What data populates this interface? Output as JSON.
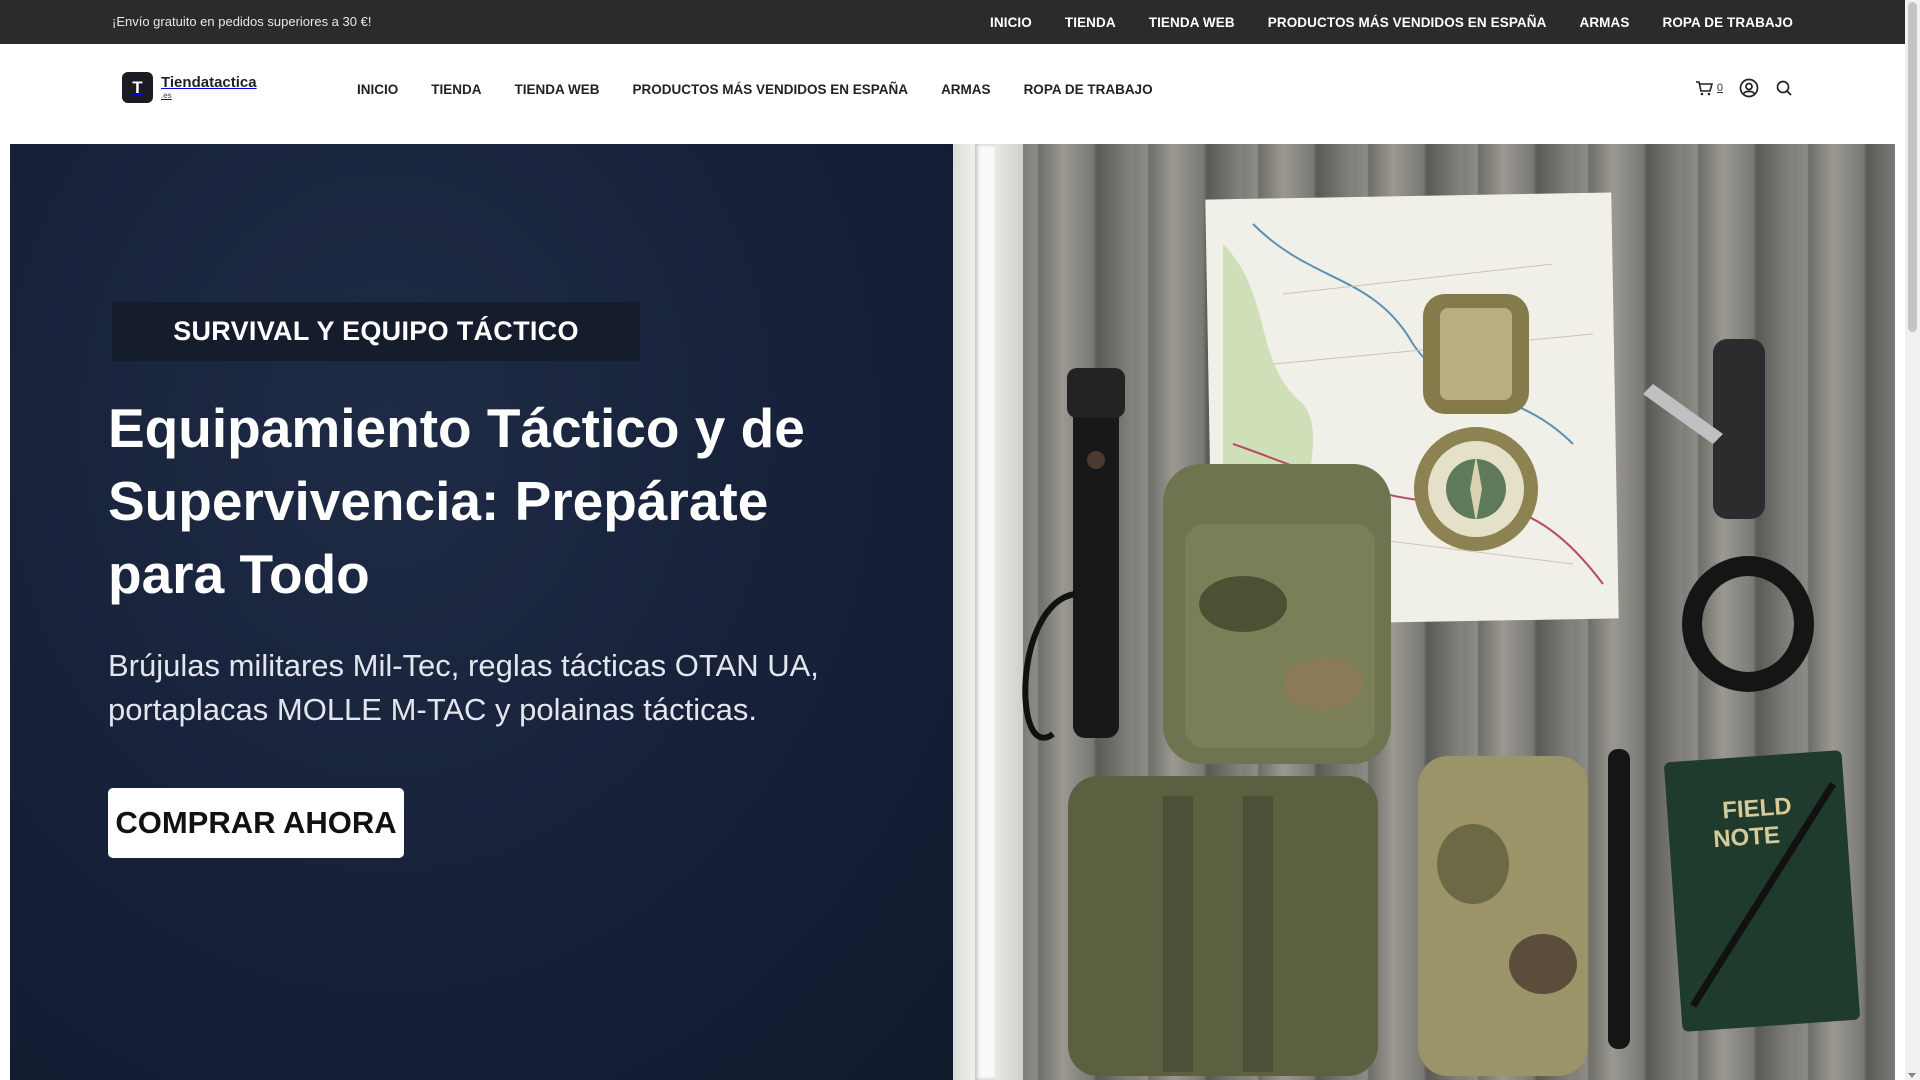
{
  "topbar": {
    "promo": "¡Envío gratuito en pedidos superiores a 30 €!",
    "nav": [
      "INICIO",
      "TIENDA",
      "TIENDA WEB",
      "PRODUCTOS MÁS VENDIDOS EN ESPAÑA",
      "ARMAS",
      "ROPA DE TRABAJO"
    ]
  },
  "header": {
    "logo_mark": "T",
    "logo_name": "Tiendatactica",
    "logo_tld": ".es",
    "nav": [
      "INICIO",
      "TIENDA",
      "TIENDA WEB",
      "PRODUCTOS MÁS VENDIDOS EN ESPAÑA",
      "ARMAS",
      "ROPA DE TRABAJO"
    ],
    "cart_count": "0",
    "icons": [
      "cart-icon",
      "user-icon",
      "search-icon"
    ]
  },
  "hero": {
    "eyebrow": "SURVIVAL Y EQUIPO TÁCTICO",
    "title": "Equipamiento Táctico y de Supervivencia: Prepárate para Todo",
    "subtitle": "Brújulas militares Mil-Tec, reglas tácticas OTAN UA, portaplacas MOLLE M-TAC y polainas tácticas.",
    "cta": "COMPRAR AHORA",
    "image_alt": "tactical gear flat lay"
  },
  "colors": {
    "topbar_bg": "#2b2b2b",
    "hero_bg": "#17213a",
    "eyebrow_bg": "#151c2b",
    "cta_bg": "#ffffff"
  }
}
